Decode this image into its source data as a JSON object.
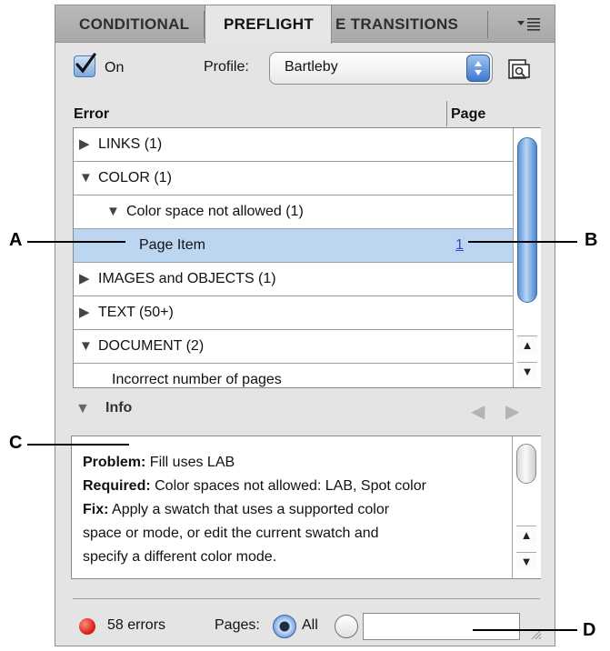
{
  "tabs": [
    {
      "label": "CONDITIONAL",
      "active": false
    },
    {
      "label": "PREFLIGHT",
      "active": true
    },
    {
      "label": "E TRANSITIONS",
      "active": false
    }
  ],
  "panel_menu_icon": "panel-menu-icon",
  "on_checkbox": {
    "label": "On",
    "checked": true
  },
  "profile": {
    "label": "Profile:",
    "value": "Bartleby"
  },
  "table": {
    "headers": {
      "error": "Error",
      "page": "Page"
    },
    "rows": [
      {
        "label": "LINKS (1)",
        "expanded": false,
        "indent": 0
      },
      {
        "label": "COLOR (1)",
        "expanded": true,
        "indent": 0
      },
      {
        "label": "Color space not allowed (1)",
        "expanded": true,
        "indent": 1
      },
      {
        "label": "Page Item",
        "page": "1",
        "selected": true,
        "indent": 2
      },
      {
        "label": "IMAGES and OBJECTS (1)",
        "expanded": false,
        "indent": 0
      },
      {
        "label": "TEXT (50+)",
        "expanded": false,
        "indent": 0
      },
      {
        "label": "DOCUMENT (2)",
        "expanded": true,
        "indent": 0
      },
      {
        "label": "Incorrect number of pages",
        "indent": 1
      }
    ]
  },
  "info": {
    "label": "Info",
    "problem_label": "Problem:",
    "problem": " Fill uses LAB",
    "required_label": "Required:",
    "required": " Color spaces not allowed: LAB, Spot color",
    "fix_label": "Fix:",
    "fix_line1": " Apply a swatch that uses a supported color",
    "fix_line2": "space or mode, or edit the current swatch and",
    "fix_line3": "specify a different color mode."
  },
  "status": {
    "errors": "58 errors",
    "pages_label": "Pages:",
    "all_label": "All",
    "range_value": ""
  },
  "callouts": {
    "a": "A",
    "b": "B",
    "c": "C",
    "d": "D"
  },
  "colors": {
    "selected_row": "#bcd6f2",
    "error_dot": "#d11a10",
    "accent": "#3d79cf"
  }
}
